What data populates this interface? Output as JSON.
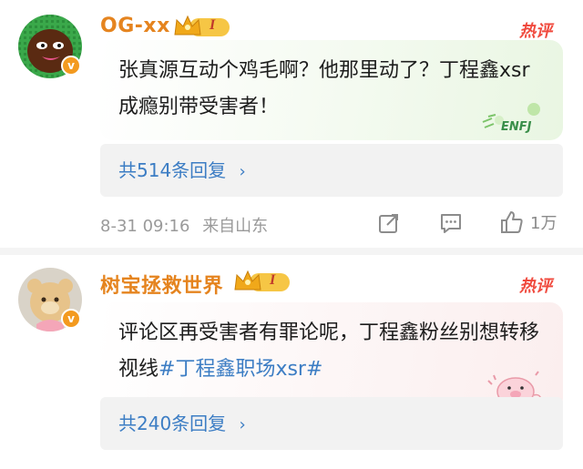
{
  "comments": [
    {
      "username": "OG-xx",
      "level_badge": "I",
      "hot_label": "热评",
      "text": "张真源互动个鸡毛啊？他那里动了？丁程鑫xsr成瘾别带受害者！",
      "sticker_text": "ENFJ",
      "replies": "共514条回复",
      "time": "8-31 09:16",
      "location": "来自山东",
      "likes": "1万"
    },
    {
      "username": "树宝拯救世界",
      "level_badge": "I",
      "hot_label": "热评",
      "text_plain": "评论区再受害者有罪论呢，丁程鑫粉丝别想转移视线",
      "hashtag": "#丁程鑫职场xsr#",
      "replies": "共240条回复"
    }
  ],
  "icons": {
    "verified": "v-badge-icon",
    "share": "share-icon",
    "comment": "comment-icon",
    "like": "thumbs-up-icon",
    "chevron": "chevron-right-icon"
  },
  "colors": {
    "username": "#e5841f",
    "link": "#3c7dc4",
    "hot": "#f04a3e",
    "meta": "#9a9a9a"
  }
}
